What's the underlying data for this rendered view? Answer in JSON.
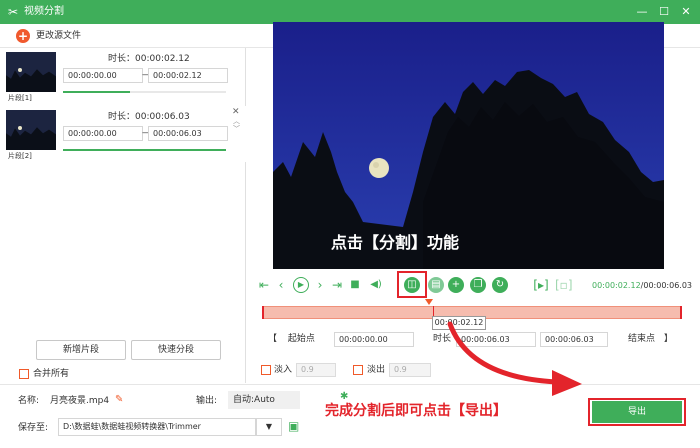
{
  "window": {
    "title": "视频分割",
    "minimize": "—",
    "maximize": "☐",
    "close": "✕"
  },
  "toolbar": {
    "change_source": "更改源文件"
  },
  "segments": [
    {
      "label": "片段[1]",
      "duration_label": "时长：",
      "duration": "00:00:02.12",
      "start": "00:00:00.00",
      "end": "00:00:02.12",
      "progress": 0.41
    },
    {
      "label": "片段[2]",
      "duration_label": "时长：",
      "duration": "00:00:06.03",
      "start": "00:00:00.00",
      "end": "00:00:06.03",
      "progress": 1.0
    }
  ],
  "left_buttons": {
    "add_segment": "新增片段",
    "quick_split": "快速分段"
  },
  "merge_all": "合并所有",
  "player": {
    "current_time": "00:00:02.12",
    "separator": "/",
    "total_time": "00:00:06.03",
    "playhead_tooltip": "00:00:02.12",
    "playhead_fraction": 0.406
  },
  "range": {
    "start_label": "起始点",
    "start_value": "00:00:00.00",
    "duration_label": "时长",
    "duration_value": "00:00:06.03",
    "end_value": "00:00:06.03",
    "end_label": "结束点"
  },
  "fade": {
    "fade_in_label": "淡入",
    "fade_in_value": "0.9",
    "fade_out_label": "淡出",
    "fade_out_value": "0.9"
  },
  "bottom": {
    "name_label": "名称:",
    "name_value": "月亮夜景.mp4",
    "output_label": "输出:",
    "output_value": "自动:Auto",
    "save_label": "保存至:",
    "save_path": "D:\\数据蛙\\数据蛙视频转换器\\Trimmer",
    "export_button": "导出"
  },
  "annotations": {
    "split_hint": "点击【分割】功能",
    "export_hint": "完成分割后即可点击【导出】"
  },
  "colors": {
    "accent": "#3fae5a",
    "highlight_red": "#e3242b",
    "timeline": "#f6bcae",
    "orange": "#f0592d"
  }
}
